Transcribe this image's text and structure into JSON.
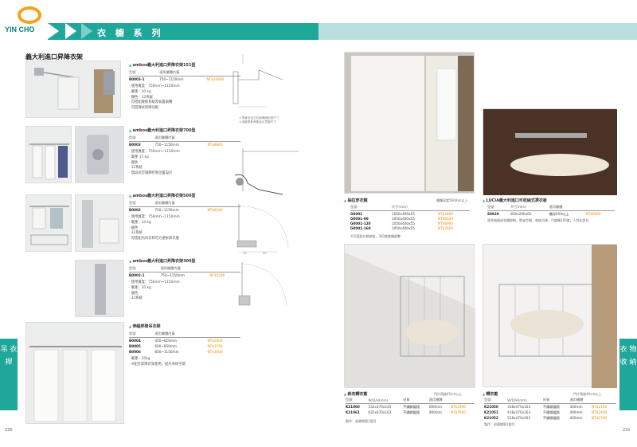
{
  "header": {
    "brand": "YIN CHO",
    "title": "衣 櫥 系 列",
    "accent": "#1fa79a"
  },
  "side_tabs": {
    "left": "吊 衣 桿",
    "right": "衣 物 收 納"
  },
  "pages": {
    "left": "230",
    "right": "231"
  },
  "left_page": {
    "section_title": "義大利進口昇降衣架",
    "products": [
      {
        "name": "ambos義大利進口昇降衣架151型",
        "headers": [
          "型號",
          "適用櫃體內寬",
          ""
        ],
        "rows": [
          [
            "B0003-1",
            "750~1150mm",
            "NT$10800"
          ]
        ],
        "features": [
          "使用寬度：750mm~1150mm",
          "載重：20 kg",
          "顏色：32系銀",
          "可搭配緩衝系統及裝置兩種",
          "可回彈式昇降功能"
        ]
      },
      {
        "name": "ambos義大利進口昇降衣架700型",
        "headers": [
          "型號",
          "適用櫃體內寬",
          ""
        ],
        "rows": [
          [
            "B0003",
            "750~1150mm",
            "NT$8800"
          ]
        ],
        "features": [
          "使用寬度：750mm~1150mm",
          "載重 15 kg",
          "銀色",
          "32系統",
          "無段式可調節控制位置設計"
        ]
      },
      {
        "name": "ambos義大利進口昇降衣架500型",
        "headers": [
          "型號",
          "適用櫃體內寬",
          ""
        ],
        "rows": [
          [
            "B0002",
            "750~1150mm",
            "NT$6100"
          ]
        ],
        "features": [
          "使用寬度：750mm~1150mm",
          "載重：10 kg",
          "銀色",
          "32系統",
          "可搭配內吊衣桿可方便拆卸衣服"
        ]
      },
      {
        "name": "ambos義大利進口昇降衣架300型",
        "headers": [
          "型號",
          "適用櫃體內寬",
          ""
        ],
        "rows": [
          [
            "B0002-1",
            "750~1150mm",
            "NT$5200"
          ]
        ],
        "features": [
          "使用寬度：750mm~1150mm",
          "載重：10 kg",
          "銀色",
          "32系統"
        ]
      },
      {
        "name": "伸縮昇降吊衣桿",
        "headers": [
          "型號",
          "適用櫃體內寬",
          ""
        ],
        "rows": [
          [
            "B0004",
            "450~620mm",
            "NT$2600"
          ],
          [
            "B0005",
            "600~850mm",
            "NT$3150"
          ],
          [
            "B0006",
            "850~1150mm",
            "NT$3500"
          ]
        ],
        "features": [
          "載重：10kg",
          "※配合昇降衣架使用，提升吊掛空間"
        ]
      }
    ],
    "drawing_notes": [
      "＊寬度包含左右兩側固定座尺寸",
      "＊深度請參考產品示意圖尺寸"
    ],
    "dims": [
      "10",
      "20"
    ]
  },
  "right_page": {
    "products": [
      {
        "name": "抽拉穿衣鏡",
        "note": "櫃體深度560mm以上",
        "headers": [
          "型號",
          "尺寸(mm)",
          ""
        ],
        "rows": [
          [
            "G0001",
            "1050x400x55",
            "NT$5800"
          ],
          [
            "G0001-90",
            "1050x400x55",
            "NT$6400"
          ],
          [
            "G0001-120",
            "1050x400x55",
            "NT$6900"
          ],
          [
            "G0001-160",
            "1050x400x55",
            "NT$7600"
          ]
        ],
        "foot": "※可搭配左側安裝，360度旋轉調整"
      },
      {
        "name": "LUCIA義大利進口可收納式燙衣板",
        "note": "",
        "headers": [
          "型號",
          "尺寸(mm)",
          "適用櫃體"
        ],
        "rows": [
          [
            "S0920",
            "830x290x60",
            "櫃深450以上",
            "NT$6600"
          ]
        ],
        "foot": "適合抽屜或衣櫃收納，節省空間，收納方便，可旋轉180度，人性化設計"
      },
      {
        "name": "斜向轉衣籃",
        "note": "門片高度45cm以上",
        "headers": [
          "型號",
          "W/D/H(mm)",
          "材質",
          "適用櫃體",
          ""
        ],
        "rows": [
          [
            "K21060",
            "532x470x163",
            "不鏽鋼鍍鉻",
            "600mm",
            "NT$2900"
          ],
          [
            "K21061",
            "632x470x163",
            "不鏽鋼鍍鉻",
            "900mm",
            "NT$3500"
          ]
        ],
        "foot": "製作：退貨期限1個月"
      },
      {
        "name": "轉衣籃",
        "note": "門片高度40cm以上",
        "headers": [
          "型號",
          "W/D/H(mm)",
          "材質",
          "適用櫃體",
          ""
        ],
        "rows": [
          [
            "K21050",
            "318x470x163",
            "不鏽鋼鍍鉻",
            "300mm",
            "NT$2100"
          ],
          [
            "K21051",
            "418x470x163",
            "不鏽鋼鍍鉻",
            "400mm",
            "NT$2400"
          ],
          [
            "K21052",
            "518x470x163",
            "不鏽鋼鍍鉻",
            "450mm",
            "NT$2700"
          ]
        ],
        "foot": "製作：退貨期限1個月"
      }
    ]
  }
}
